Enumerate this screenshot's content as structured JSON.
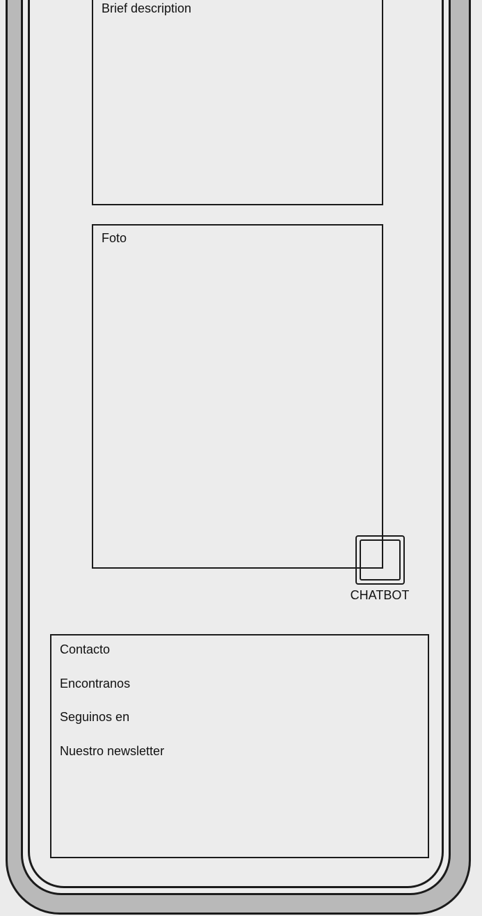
{
  "description_panel": {
    "label": "Brief description"
  },
  "photo_panel": {
    "label": "Foto"
  },
  "chatbot": {
    "label": "CHATBOT",
    "icon": "chat-window-icon"
  },
  "footer": {
    "items": [
      {
        "label": "Contacto"
      },
      {
        "label": "Encontranos"
      },
      {
        "label": "Seguinos en"
      },
      {
        "label": "Nuestro newsletter"
      }
    ]
  }
}
